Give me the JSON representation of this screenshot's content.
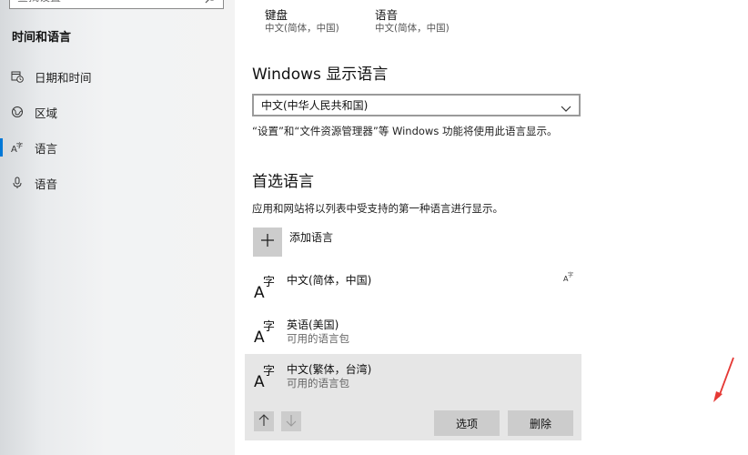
{
  "sidebar": {
    "search_placeholder": "查找设置",
    "section_title": "时间和语言",
    "items": [
      {
        "label": "日期和时间",
        "icon": "calendar-clock-icon"
      },
      {
        "label": "区域",
        "icon": "globe-icon"
      },
      {
        "label": "语言",
        "icon": "language-icon",
        "selected": true
      },
      {
        "label": "语音",
        "icon": "microphone-icon"
      }
    ]
  },
  "top_items": [
    {
      "title": "键盘",
      "subtitle": "中文(简体，中国)"
    },
    {
      "title": "语音",
      "subtitle": "中文(简体，中国)"
    }
  ],
  "display_language": {
    "heading": "Windows 显示语言",
    "selected": "中文(中华人民共和国)",
    "note": "“设置”和“文件资源管理器”等 Windows 功能将使用此语言显示。"
  },
  "preferred": {
    "heading": "首选语言",
    "description": "应用和网站将以列表中受支持的第一种语言进行显示。",
    "add_label": "添加语言",
    "languages": [
      {
        "name": "中文(简体，中国)",
        "sub": ""
      },
      {
        "name": "英语(美国)",
        "sub": "可用的语言包"
      },
      {
        "name": "中文(繁体，台湾)",
        "sub": "可用的语言包"
      }
    ],
    "options_button": "选项",
    "remove_button": "删除"
  },
  "colors": {
    "accent": "#0078d7",
    "annotation": "#e53935",
    "button_gray": "#cccccc",
    "selected_row": "#e6e6e6"
  }
}
